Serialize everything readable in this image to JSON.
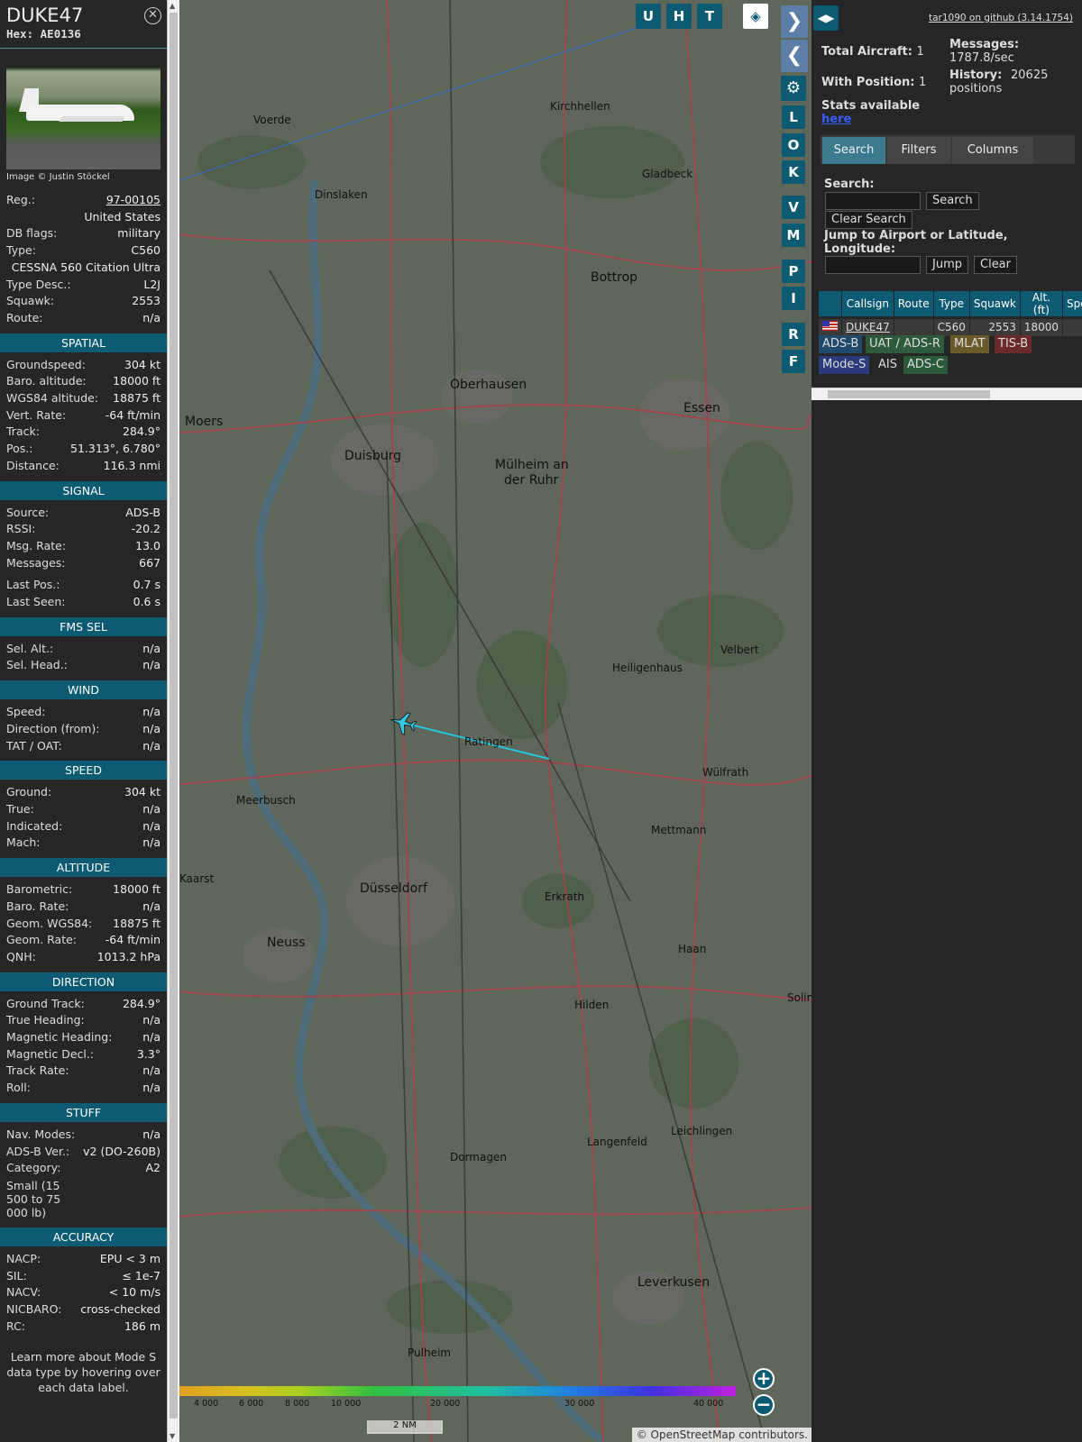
{
  "aircraft": {
    "callsign": "DUKE47",
    "hex_label": "Hex:",
    "hex": "AE0136",
    "photo_credit": "Image © Justin Stöckel"
  },
  "details": [
    {
      "label": "Reg.:",
      "value": "97-00105",
      "link": true
    },
    {
      "label": "",
      "value": "United States"
    },
    {
      "label": "DB flags:",
      "value": "military"
    },
    {
      "label": "Type:",
      "value": "C560"
    },
    {
      "label": "",
      "value": "CESSNA 560 Citation Ultra"
    },
    {
      "label": "Type Desc.:",
      "value": "L2J"
    },
    {
      "label": "Squawk:",
      "value": "2553"
    },
    {
      "label": "Route:",
      "value": "n/a"
    }
  ],
  "sections": [
    {
      "title": "SPATIAL",
      "rows": [
        {
          "label": "Groundspeed:",
          "value": "304 kt"
        },
        {
          "label": "Baro. altitude:",
          "value": "18000 ft"
        },
        {
          "label": "WGS84 altitude:",
          "value": "18875 ft"
        },
        {
          "label": "Vert. Rate:",
          "value": "-64 ft/min"
        },
        {
          "label": "Track:",
          "value": "284.9°"
        },
        {
          "label": "Pos.:",
          "value": "51.313°, 6.780°"
        },
        {
          "label": "Distance:",
          "value": "116.3 nmi"
        }
      ]
    },
    {
      "title": "SIGNAL",
      "rows": [
        {
          "label": "Source:",
          "value": "ADS-B"
        },
        {
          "label": "RSSI:",
          "value": "-20.2"
        },
        {
          "label": "Msg. Rate:",
          "value": "13.0"
        },
        {
          "label": "Messages:",
          "value": "667"
        },
        {
          "gap": true
        },
        {
          "label": "Last Pos.:",
          "value": "0.7 s"
        },
        {
          "label": "Last Seen:",
          "value": "0.6 s"
        }
      ]
    },
    {
      "title": "FMS SEL",
      "rows": [
        {
          "label": "Sel. Alt.:",
          "value": "n/a"
        },
        {
          "label": "Sel. Head.:",
          "value": "n/a"
        }
      ]
    },
    {
      "title": "WIND",
      "rows": [
        {
          "label": "Speed:",
          "value": "n/a"
        },
        {
          "label": "Direction (from):",
          "value": "n/a"
        },
        {
          "label": "TAT / OAT:",
          "value": "n/a"
        }
      ]
    },
    {
      "title": "SPEED",
      "rows": [
        {
          "label": "Ground:",
          "value": "304 kt"
        },
        {
          "label": "True:",
          "value": "n/a"
        },
        {
          "label": "Indicated:",
          "value": "n/a"
        },
        {
          "label": "Mach:",
          "value": "n/a"
        }
      ]
    },
    {
      "title": "ALTITUDE",
      "rows": [
        {
          "label": "Barometric:",
          "value": "18000 ft"
        },
        {
          "label": "Baro. Rate:",
          "value": "n/a"
        },
        {
          "label": "Geom. WGS84:",
          "value": "18875 ft"
        },
        {
          "label": "Geom. Rate:",
          "value": "-64 ft/min"
        },
        {
          "label": "QNH:",
          "value": "1013.2 hPa"
        }
      ]
    },
    {
      "title": "DIRECTION",
      "rows": [
        {
          "label": "Ground Track:",
          "value": "284.9°"
        },
        {
          "label": "True Heading:",
          "value": "n/a"
        },
        {
          "label": "Magnetic Heading:",
          "value": "n/a"
        },
        {
          "label": "Magnetic Decl.:",
          "value": "3.3°"
        },
        {
          "label": "Track Rate:",
          "value": "n/a"
        },
        {
          "label": "Roll:",
          "value": "n/a"
        }
      ]
    },
    {
      "title": "STUFF",
      "rows": [
        {
          "label": "Nav. Modes:",
          "value": "n/a"
        },
        {
          "label": "ADS-B Ver.:",
          "value": "v2 (DO-260B)"
        },
        {
          "label": "Category:",
          "value": "A2"
        },
        {
          "label": "Small (15 500 to 75 000 lb)",
          "value": "",
          "full": true
        }
      ]
    },
    {
      "title": "ACCURACY",
      "rows": [
        {
          "label": "NACP:",
          "value": "EPU < 3 m"
        },
        {
          "label": "SIL:",
          "value": "≤ 1e-7"
        },
        {
          "label": "NACV:",
          "value": "< 10 m/s"
        },
        {
          "label": "NICBARO:",
          "value": "cross-checked"
        },
        {
          "label": "RC:",
          "value": "186 m"
        }
      ]
    }
  ],
  "sidebar_footer": "Learn more about Mode S data type by hovering over each data label.",
  "map": {
    "buttons_top": [
      "U",
      "H",
      "T"
    ],
    "buttons_side": [
      "L",
      "O",
      "K",
      "V",
      "M",
      "P",
      "I",
      "R",
      "F"
    ],
    "cities": [
      {
        "name": "Duisburg",
        "big": true
      },
      {
        "name": "Düsseldorf",
        "big": true
      },
      {
        "name": "Oberhausen",
        "big": true
      },
      {
        "name": "Bottrop",
        "big": true
      },
      {
        "name": "Essen",
        "big": true
      },
      {
        "name": "Moers",
        "big": true
      },
      {
        "name": "Neuss",
        "big": true
      },
      {
        "name": "Mülheim an",
        "big": true
      },
      {
        "name": "der Ruhr",
        "big": true
      },
      {
        "name": "Ratingen"
      },
      {
        "name": "Heiligenhaus"
      },
      {
        "name": "Velbert"
      },
      {
        "name": "Wülfrath"
      },
      {
        "name": "Mettmann"
      },
      {
        "name": "Erkrath"
      },
      {
        "name": "Haan"
      },
      {
        "name": "Hilden"
      },
      {
        "name": "Langenfeld"
      },
      {
        "name": "Leichlingen"
      },
      {
        "name": "Leverkusen",
        "big": true
      },
      {
        "name": "Dormagen"
      },
      {
        "name": "Meerbusch"
      },
      {
        "name": "Kaarst"
      },
      {
        "name": "Kirchhellen"
      },
      {
        "name": "Gladbeck"
      },
      {
        "name": "Dinslaken"
      },
      {
        "name": "Voerde"
      },
      {
        "name": "Pulheim"
      },
      {
        "name": "Solin"
      }
    ],
    "scale_bar": "2 NM",
    "altitude_ticks": [
      "4 000",
      "6 000",
      "8 000",
      "10 000",
      "20 000",
      "30 000",
      "40 000"
    ],
    "attribution": "© OpenStreetMap contributors."
  },
  "right": {
    "github_link": "tar1090 on github (3.14.1754)",
    "total_aircraft_label": "Total Aircraft:",
    "total_aircraft": "1",
    "with_position_label": "With Position:",
    "with_position": "1",
    "messages_label": "Messages:",
    "messages": "1787.8/sec",
    "history_label": "History:",
    "history": "20625 positions",
    "stats_label": "Stats available",
    "stats_link": "here",
    "tabs": [
      "Search",
      "Filters",
      "Columns"
    ],
    "search_label": "Search:",
    "search_button": "Search",
    "clear_search_button": "Clear Search",
    "jump_label": "Jump to Airport or Latitude, Longitude:",
    "jump_button": "Jump",
    "clear_button": "Clear",
    "table_headers": [
      "",
      "Callsign",
      "Route",
      "Type",
      "Squawk",
      "Alt. (ft)",
      "Spd."
    ],
    "table_rows": [
      [
        "",
        "DUKE47",
        "",
        "C560",
        "2553",
        "18000",
        ""
      ]
    ],
    "legend": [
      {
        "label": "ADS-B",
        "color": "#1f4a6b"
      },
      {
        "label": "UAT / ADS-R",
        "color": "#2c5a3a"
      },
      {
        "label": "MLAT",
        "color": "#6a5a2a"
      },
      {
        "label": "TIS-B",
        "color": "#6a2a2a"
      },
      {
        "label": "Mode-S",
        "color": "#2a3a7a"
      },
      {
        "label": "AIS",
        "color": "transparent"
      },
      {
        "label": "ADS-C",
        "color": "#2a5a3a"
      }
    ]
  }
}
